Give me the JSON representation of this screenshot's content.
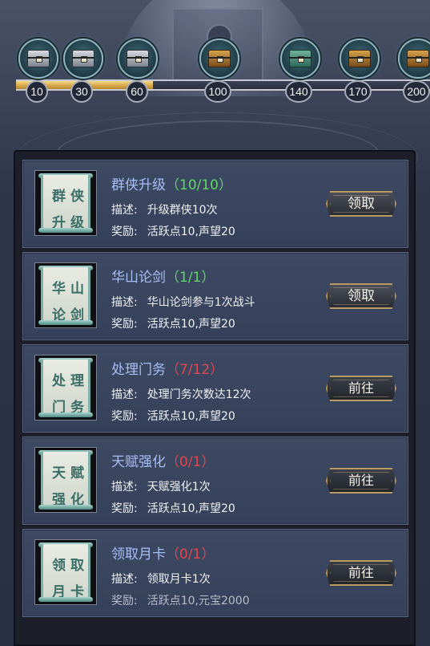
{
  "progress": {
    "fill_fraction": 0.33,
    "milestones": [
      {
        "value": "10",
        "state": "claimed",
        "icon": "silver-chest-icon"
      },
      {
        "value": "30",
        "state": "claimed",
        "icon": "silver-chest-icon"
      },
      {
        "value": "60",
        "state": "claimed",
        "icon": "silver-chest-icon"
      },
      {
        "value": "100",
        "state": "locked",
        "icon": "gold-chest-icon"
      },
      {
        "value": "140",
        "state": "locked",
        "icon": "jade-chest-icon"
      },
      {
        "value": "170",
        "state": "locked",
        "icon": "gold-chest-icon"
      },
      {
        "value": "200",
        "state": "locked",
        "icon": "gold-chest-icon"
      }
    ]
  },
  "tasks": [
    {
      "scroll_chars": [
        "群",
        "侠",
        "升",
        "级"
      ],
      "title": "群侠升级",
      "count": "（10/10）",
      "count_done": true,
      "desc_label": "描述:",
      "desc": "升级群侠10次",
      "reward_label": "奖励:",
      "reward": "活跃点10,声望20",
      "button": "领取"
    },
    {
      "scroll_chars": [
        "华",
        "山",
        "论",
        "剑"
      ],
      "title": "华山论剑",
      "count": "（1/1）",
      "count_done": true,
      "desc_label": "描述:",
      "desc": "华山论剑参与1次战斗",
      "reward_label": "奖励:",
      "reward": "活跃点10,声望20",
      "button": "领取"
    },
    {
      "scroll_chars": [
        "处",
        "理",
        "门",
        "务"
      ],
      "title": "处理门务",
      "count": "（7/12）",
      "count_done": false,
      "desc_label": "描述:",
      "desc": "处理门务次数达12次",
      "reward_label": "奖励:",
      "reward": "活跃点10,声望20",
      "button": "前往"
    },
    {
      "scroll_chars": [
        "天",
        "赋",
        "强",
        "化"
      ],
      "title": "天赋强化",
      "count": "（0/1）",
      "count_done": false,
      "desc_label": "描述:",
      "desc": "天赋强化1次",
      "reward_label": "奖励:",
      "reward": "活跃点10,声望20",
      "button": "前往"
    },
    {
      "scroll_chars": [
        "领",
        "取",
        "月",
        "卡"
      ],
      "title": "领取月卡",
      "count": "（0/1）",
      "count_done": false,
      "desc_label": "描述:",
      "desc": "领取月卡1次",
      "reward_label": "奖励:",
      "reward": "活跃点10,元宝2000",
      "button": "前往"
    }
  ]
}
